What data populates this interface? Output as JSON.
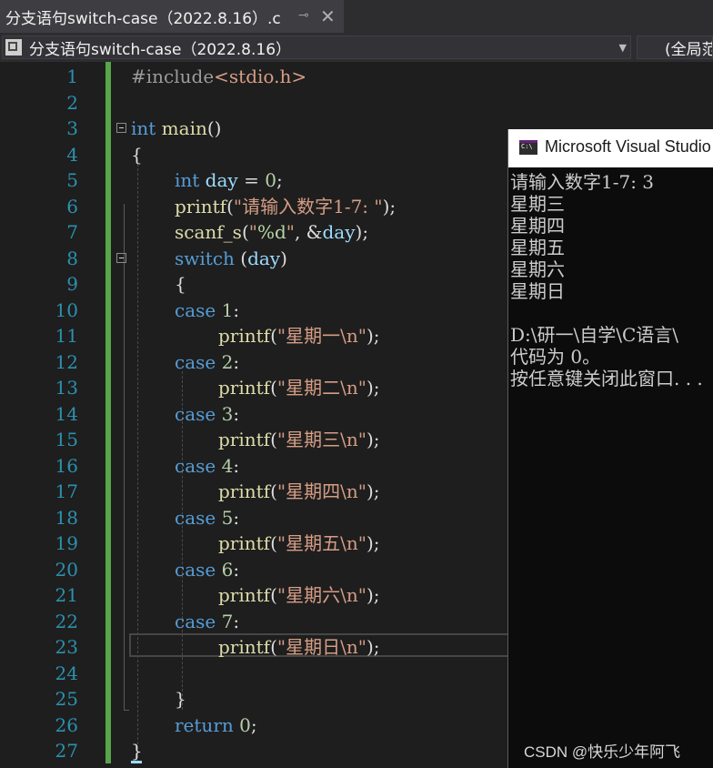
{
  "tab": {
    "title": "分支语句switch-case（2022.8.16）.c",
    "pin": "⊸",
    "close": "✕"
  },
  "nav": {
    "project": "分支语句switch-case（2022.8.16）",
    "scope": "(全局范"
  },
  "line_numbers": [
    "1",
    "2",
    "3",
    "4",
    "5",
    "6",
    "7",
    "8",
    "9",
    "10",
    "11",
    "12",
    "13",
    "14",
    "15",
    "16",
    "17",
    "18",
    "19",
    "20",
    "21",
    "22",
    "23",
    "24",
    "25",
    "26",
    "27"
  ],
  "code": {
    "l1_pp": "#include",
    "l1_inc": "<stdio.h>",
    "l3_kw": "int",
    "l3_fn": " main",
    "l3_rest": "()",
    "l4": "{",
    "l5_kw": "int",
    "l5_var": " day",
    "l5_eq": " = ",
    "l5_num": "0",
    "l5_end": ";",
    "l6_fn": "printf",
    "l6_open": "(",
    "l6_str": "\"请输入数字1-7: \"",
    "l6_end": ");",
    "l7_fn": "scanf_s",
    "l7_open": "(",
    "l7_str1": "\"",
    "l7_fmt": "%d",
    "l7_str2": "\"",
    "l7_mid": ", &",
    "l7_var": "day",
    "l7_end": ");",
    "l8_kw": "switch",
    "l8_open": " (",
    "l8_var": "day",
    "l8_close": ")",
    "l9": "{",
    "cases": [
      {
        "kw": "case",
        "num": " 1",
        "colon": ":",
        "fn": "printf",
        "str": "\"星期一\\n\""
      },
      {
        "kw": "case",
        "num": " 2",
        "colon": ":",
        "fn": "printf",
        "str": "\"星期二\\n\""
      },
      {
        "kw": "case",
        "num": " 3",
        "colon": ":",
        "fn": "printf",
        "str": "\"星期三\\n\""
      },
      {
        "kw": "case",
        "num": " 4",
        "colon": ":",
        "fn": "printf",
        "str": "\"星期四\\n\""
      },
      {
        "kw": "case",
        "num": " 5",
        "colon": ":",
        "fn": "printf",
        "str": "\"星期五\\n\""
      },
      {
        "kw": "case",
        "num": " 6",
        "colon": ":",
        "fn": "printf",
        "str": "\"星期六\\n\""
      },
      {
        "kw": "case",
        "num": " 7",
        "colon": ":",
        "fn": "printf",
        "str": "\"星期日\\n\""
      }
    ],
    "call_open": "(",
    "call_end": ");",
    "l25": "}",
    "l26_kw": "return",
    "l26_num": " 0",
    "l26_end": ";",
    "l27": "}"
  },
  "console": {
    "title": "Microsoft Visual Studio",
    "output": "请输入数字1-7: 3\n星期三\n星期四\n星期五\n星期六\n星期日\n\nD:\\研一\\自学\\C语言\\\n代码为 0。\n按任意键关闭此窗口. . ."
  },
  "watermark": "CSDN @快乐少年阿飞"
}
